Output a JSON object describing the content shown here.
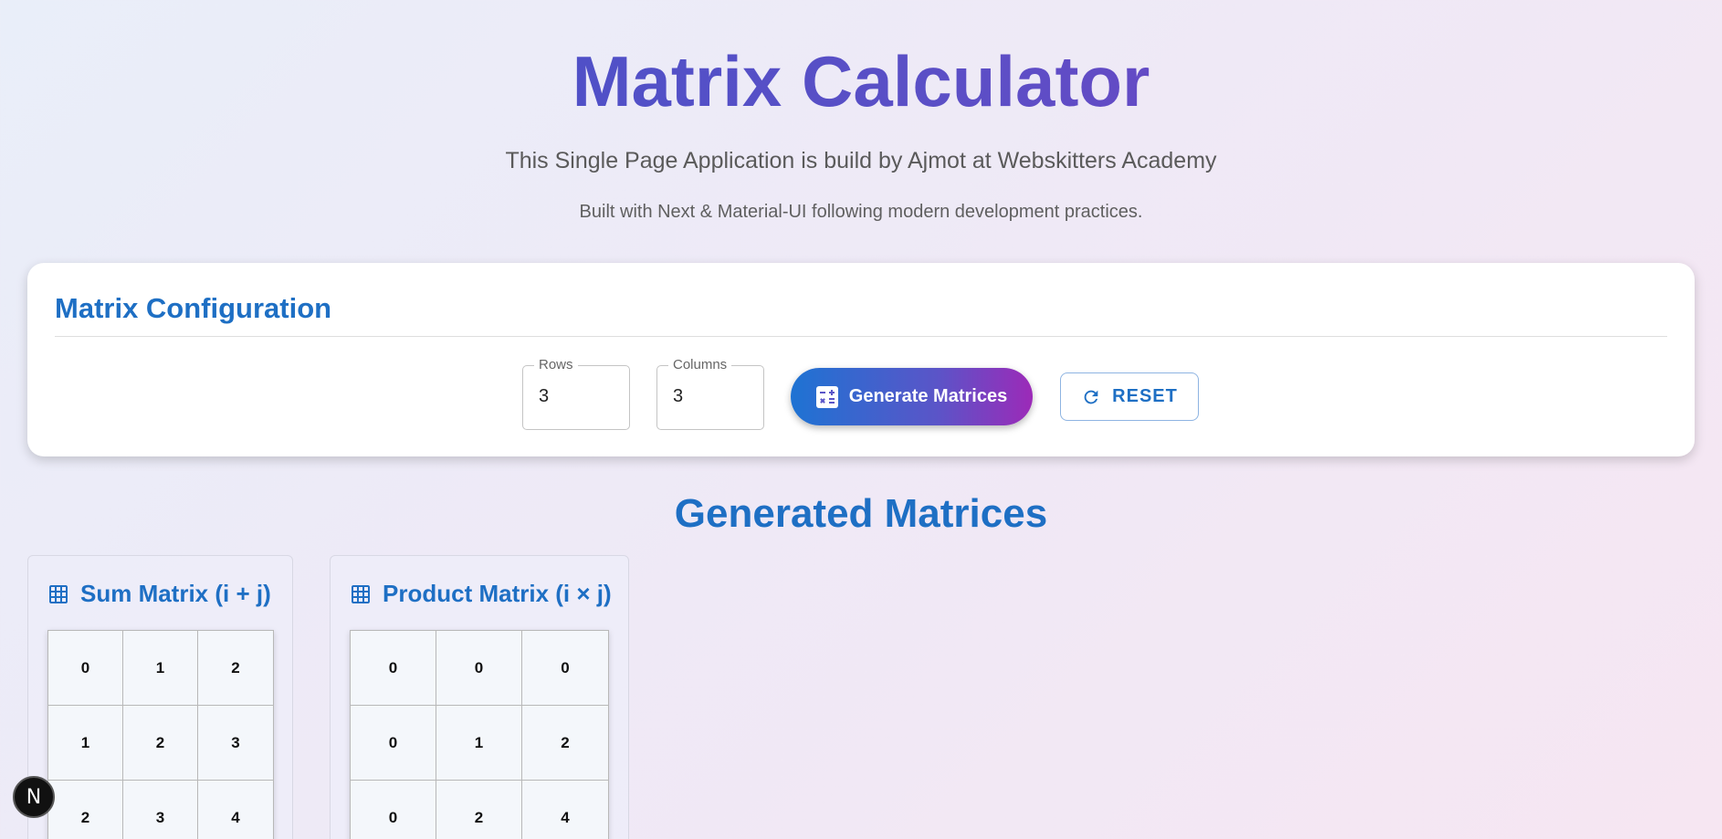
{
  "header": {
    "title": "Matrix Calculator",
    "subtitle": "This Single Page Application is build by Ajmot at Webskitters Academy",
    "subtext": "Built with Next & Material-UI following modern development practices."
  },
  "config": {
    "title": "Matrix Configuration",
    "rows_label": "Rows",
    "rows_value": "3",
    "columns_label": "Columns",
    "columns_value": "3",
    "generate_label": "Generate Matrices",
    "generate_icon": "calculate-icon",
    "reset_label": "RESET",
    "reset_icon": "refresh-icon"
  },
  "results": {
    "title": "Generated Matrices",
    "matrices": [
      {
        "title": "Sum Matrix (i + j)",
        "icon": "grid-icon",
        "values": [
          [
            "0",
            "1",
            "2"
          ],
          [
            "1",
            "2",
            "3"
          ],
          [
            "2",
            "3",
            "4"
          ]
        ]
      },
      {
        "title": "Product Matrix (i × j)",
        "icon": "grid-icon",
        "values": [
          [
            "0",
            "0",
            "0"
          ],
          [
            "0",
            "1",
            "2"
          ],
          [
            "0",
            "2",
            "4"
          ]
        ]
      }
    ]
  },
  "badge": {
    "label": "N"
  },
  "colors": {
    "accent": "#1e6fc4",
    "gradient_start": "#1e73d3",
    "gradient_end": "#9c2ab8"
  }
}
